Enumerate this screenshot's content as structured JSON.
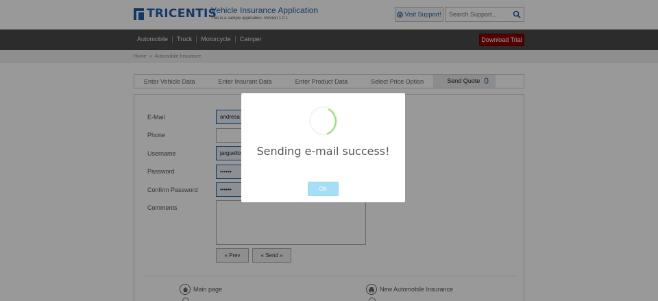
{
  "header": {
    "brand": "TRICENTIS",
    "app_title": "Vehicle Insurance Application",
    "app_subtitle": "This is a sample application. Version 1.0.1",
    "visit_support": "Visit Support!",
    "search_placeholder": "Search Support..."
  },
  "nav": {
    "items": [
      {
        "label": "Automobile"
      },
      {
        "label": "Truck"
      },
      {
        "label": "Motorcycle"
      },
      {
        "label": "Camper"
      }
    ],
    "download_label": "Download Trial"
  },
  "breadcrumb": {
    "home": "Home",
    "separator": "»",
    "current": "Automobile Insurance"
  },
  "steps": {
    "items": [
      {
        "label": "Enter Vehicle Data"
      },
      {
        "label": "Enter Insurant Data"
      },
      {
        "label": "Enter Product Data"
      },
      {
        "label": "Select Price Option"
      }
    ],
    "active_label": "Send Quote",
    "active_count": "0"
  },
  "form": {
    "email_label": "E-Mail",
    "email_value": "andresa",
    "phone_label": "Phone",
    "phone_value": "",
    "username_label": "Username",
    "username_value": "jarguello",
    "password_label": "Password",
    "password_value": "••••••",
    "confirm_label": "Confirm Password",
    "confirm_value": "••••••",
    "comments_label": "Comments",
    "prev_label": "« Prev",
    "send_label": "« Send »"
  },
  "footer": {
    "main_page": "Main page",
    "new_auto": "New Automobile Insurance"
  },
  "modal": {
    "title": "Sending e-mail success!",
    "ok_label": "OK"
  },
  "colors": {
    "brand": "#1f5fa8",
    "nav_bg": "#4a4a4a",
    "download_bg": "#8b0000",
    "ok_button": "#a5dff5",
    "spinner": "#a5dc86"
  }
}
